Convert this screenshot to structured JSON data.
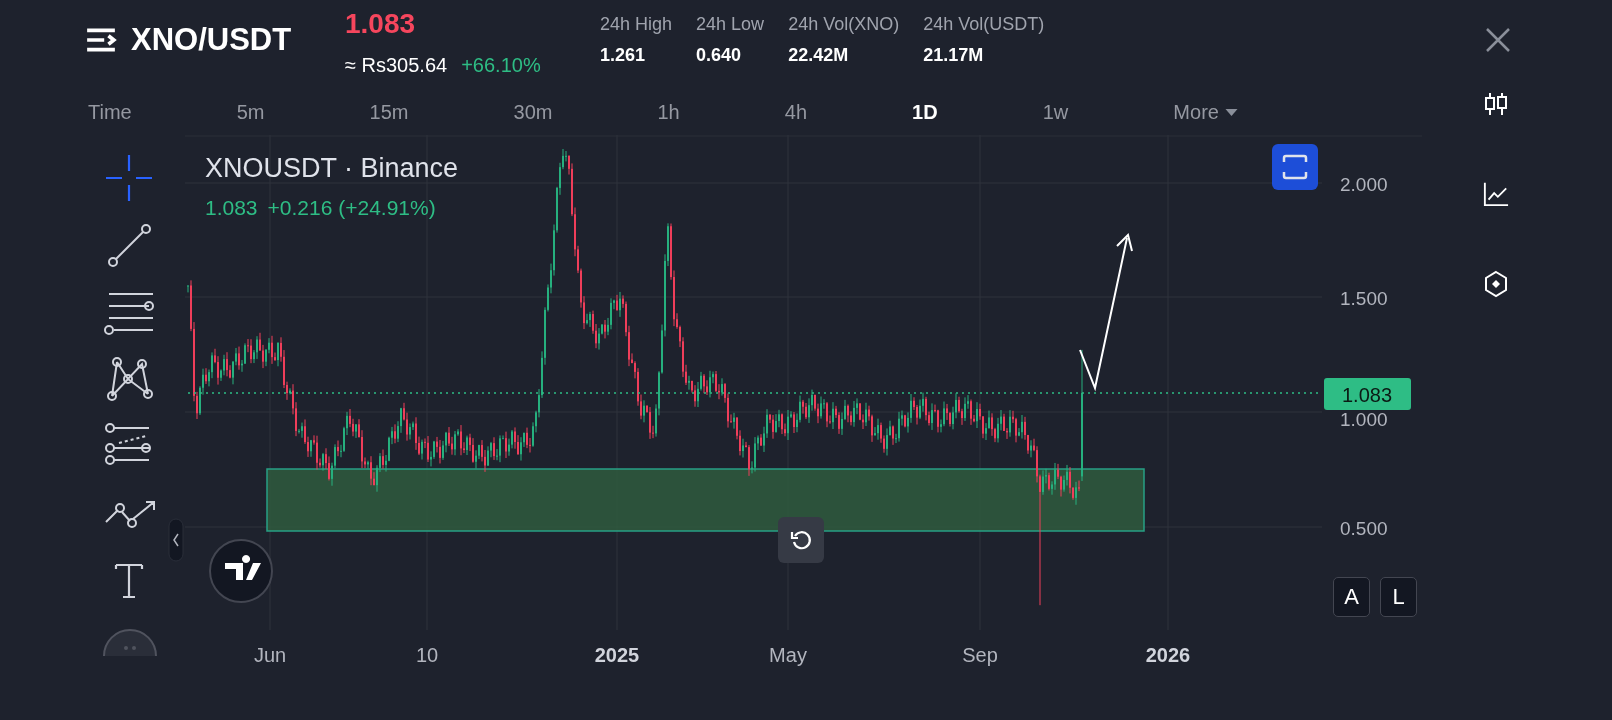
{
  "header": {
    "pair": "XNO/USDT",
    "price": "1.083",
    "converted": "≈ Rs305.64",
    "change": "+66.10%",
    "stats": [
      {
        "label": "24h High",
        "value": "1.261"
      },
      {
        "label": "24h Low",
        "value": "0.640"
      },
      {
        "label": "24h Vol(XNO)",
        "value": "22.42M"
      },
      {
        "label": "24h Vol(USDT)",
        "value": "21.17M"
      }
    ]
  },
  "intervals": [
    {
      "label": "Time",
      "kind": "caption"
    },
    {
      "label": "5m",
      "kind": "tab",
      "selected": false
    },
    {
      "label": "15m",
      "kind": "tab",
      "selected": false
    },
    {
      "label": "30m",
      "kind": "tab",
      "selected": false
    },
    {
      "label": "1h",
      "kind": "tab",
      "selected": false
    },
    {
      "label": "4h",
      "kind": "tab",
      "selected": false
    },
    {
      "label": "1D",
      "kind": "tab",
      "selected": true
    },
    {
      "label": "1w",
      "kind": "tab",
      "selected": false
    },
    {
      "label": "More",
      "kind": "menu",
      "selected": false
    }
  ],
  "tools": [
    {
      "kind": "crosshair",
      "selected": true
    },
    {
      "kind": "trend-line",
      "selected": false
    },
    {
      "kind": "parallel-lines",
      "selected": false
    },
    {
      "kind": "pattern",
      "selected": false
    },
    {
      "kind": "fib",
      "selected": false
    },
    {
      "kind": "path",
      "selected": false
    },
    {
      "kind": "text",
      "selected": false
    }
  ],
  "chart": {
    "symbol": "XNOUSDT · Binance",
    "last": "1.083",
    "delta": "+0.216 (+24.91%)",
    "last_badge": "1.083",
    "price_labels": [
      "2.000",
      "1.500",
      "1.000",
      "0.500"
    ],
    "time_labels": [
      {
        "label": "Jun",
        "bold": false
      },
      {
        "label": "10",
        "bold": false
      },
      {
        "label": "2025",
        "bold": true
      },
      {
        "label": "May",
        "bold": false
      },
      {
        "label": "Sep",
        "bold": false
      },
      {
        "label": "2026",
        "bold": true
      }
    ],
    "scale_buttons": [
      "A",
      "L"
    ]
  }
}
